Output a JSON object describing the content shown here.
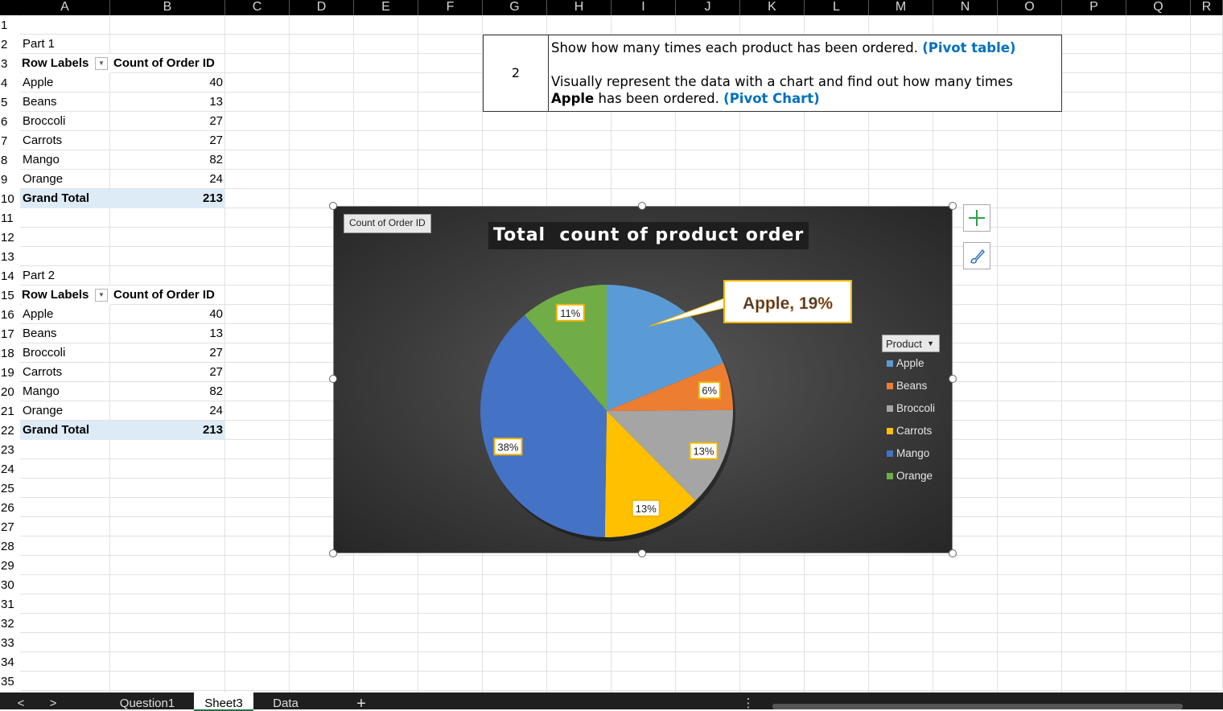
{
  "columns": [
    "A",
    "B",
    "C",
    "D",
    "E",
    "F",
    "G",
    "H",
    "I",
    "J",
    "K",
    "L",
    "M",
    "N",
    "O",
    "P",
    "Q",
    "R"
  ],
  "rows": [
    "1",
    "2",
    "3",
    "4",
    "5",
    "6",
    "7",
    "8",
    "9",
    "10",
    "11",
    "12",
    "13",
    "14",
    "15",
    "16",
    "17",
    "18",
    "19",
    "20",
    "21",
    "22",
    "23",
    "24",
    "25",
    "26",
    "27",
    "28",
    "29",
    "30",
    "31",
    "32",
    "33",
    "34",
    "35"
  ],
  "part1": {
    "label": "Part 1",
    "header_row_labels": "Row Labels",
    "header_count": "Count of Order ID",
    "items": [
      {
        "name": "Apple",
        "count": "40"
      },
      {
        "name": "Beans",
        "count": "13"
      },
      {
        "name": "Broccoli",
        "count": "27"
      },
      {
        "name": "Carrots",
        "count": "27"
      },
      {
        "name": "Mango",
        "count": "82"
      },
      {
        "name": "Orange",
        "count": "24"
      }
    ],
    "total_label": "Grand Total",
    "total_value": "213"
  },
  "part2": {
    "label": "Part  2",
    "header_row_labels": "Row Labels",
    "header_count": "Count of Order ID",
    "items": [
      {
        "name": "Apple",
        "count": "40"
      },
      {
        "name": "Beans",
        "count": "13"
      },
      {
        "name": "Broccoli",
        "count": "27"
      },
      {
        "name": "Carrots",
        "count": "27"
      },
      {
        "name": "Mango",
        "count": "82"
      },
      {
        "name": "Orange",
        "count": "24"
      }
    ],
    "total_label": "Grand Total",
    "total_value": "213"
  },
  "instruction": {
    "number": "2",
    "line1": "Show how many times each product has been ordered.",
    "line1_link": "(Pivot table)",
    "line2": "Visually represent the data with a chart and find out how many times",
    "line3_bold": "Apple",
    "line3": "has been ordered.",
    "line3_link": "(Pivot Chart)"
  },
  "chart_data": {
    "type": "pie",
    "title": "Total  count of product order",
    "field_button": "Count of Order ID",
    "legend_title": "Product",
    "legend_position": "right",
    "categories": [
      "Apple",
      "Beans",
      "Broccoli",
      "Carrots",
      "Mango",
      "Orange"
    ],
    "values": [
      40,
      13,
      27,
      27,
      82,
      24
    ],
    "data_labels": [
      "Apple, 19%",
      "6%",
      "13%",
      "13%",
      "38%",
      "11%"
    ],
    "colors": [
      "#5b9bd5",
      "#ed7d31",
      "#a5a5a5",
      "#ffc000",
      "#4472c4",
      "#70ad47"
    ]
  },
  "tabs": {
    "nav_prev": "<",
    "nav_next": ">",
    "items": [
      "Question1",
      "Sheet3",
      "Data"
    ],
    "active": "Sheet3",
    "add": "+",
    "more": "⋮"
  }
}
